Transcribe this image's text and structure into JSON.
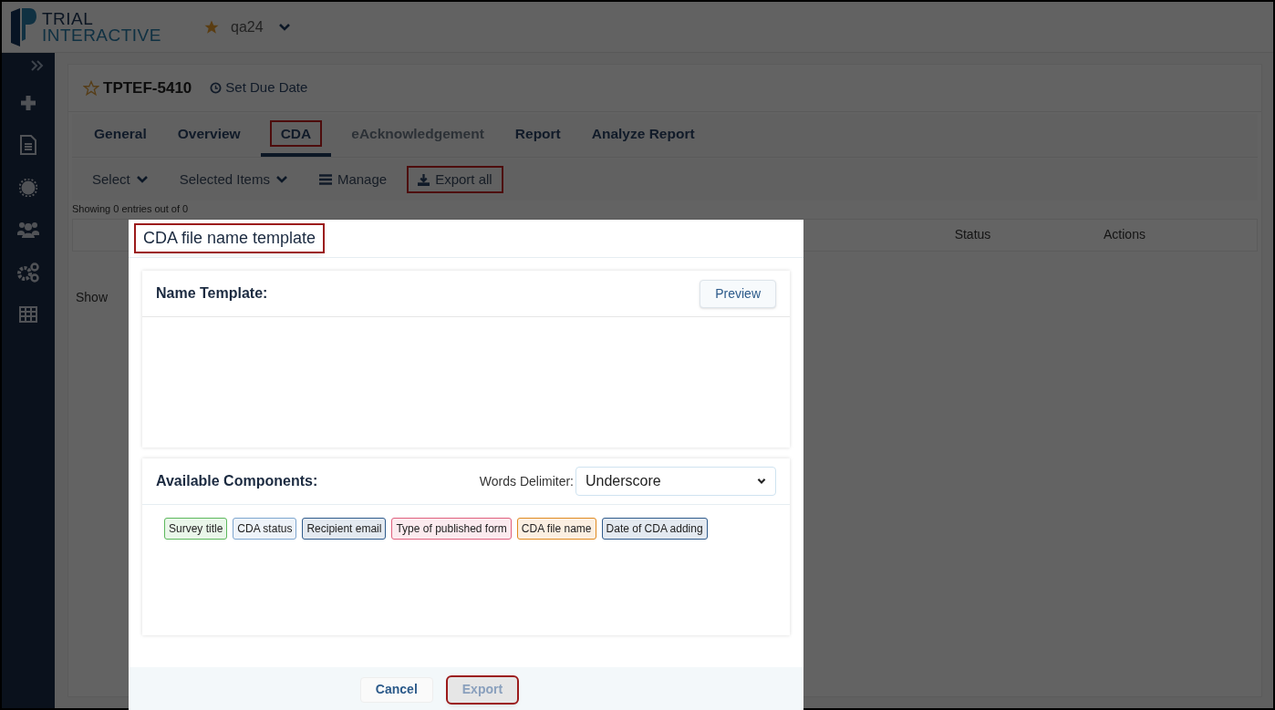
{
  "header": {
    "logo_line1": "TRIAL",
    "logo_line2": "INTERACTIVE",
    "workspace": "qa24"
  },
  "page": {
    "title": "TPTEF-5410",
    "due_date": "Set Due Date",
    "tabs": [
      {
        "label": "General",
        "selected": false,
        "disabled": false,
        "highlighted": false
      },
      {
        "label": "Overview",
        "selected": false,
        "disabled": false,
        "highlighted": false
      },
      {
        "label": "CDA",
        "selected": true,
        "disabled": false,
        "highlighted": true
      },
      {
        "label": "eAcknowledgement",
        "selected": false,
        "disabled": true,
        "highlighted": false
      },
      {
        "label": "Report",
        "selected": false,
        "disabled": false,
        "highlighted": false
      },
      {
        "label": "Analyze Report",
        "selected": false,
        "disabled": false,
        "highlighted": false
      }
    ],
    "toolbar": [
      {
        "kind": "dropdown",
        "label": "Select",
        "highlighted": false
      },
      {
        "kind": "dropdown",
        "label": "Selected Items",
        "highlighted": false
      },
      {
        "kind": "manage",
        "label": "Manage",
        "highlighted": false
      },
      {
        "kind": "export",
        "label": "Export all",
        "highlighted": true
      }
    ],
    "entries_info": "Showing 0 entries out of 0",
    "table": {
      "columns": [
        "Status",
        "Actions"
      ]
    },
    "footer_text": "Show"
  },
  "modal": {
    "title": "CDA file name template",
    "title_highlighted": true,
    "name_template": {
      "label": "Name Template:",
      "preview_button": "Preview"
    },
    "components": {
      "label": "Available Components:",
      "delimiter_label": "Words Delimiter:",
      "delimiter_value": "Underscore",
      "chips": [
        {
          "label": "Survey title",
          "color": "#5cb85c"
        },
        {
          "label": "CDA status",
          "color": "#7ea6cf"
        },
        {
          "label": "Recipient email",
          "color": "#2f5b8c"
        },
        {
          "label": "Type of published form",
          "color": "#e0607e"
        },
        {
          "label": "CDA file name",
          "color": "#e08a20"
        },
        {
          "label": "Date of CDA adding",
          "color": "#2f5b8c"
        }
      ]
    },
    "buttons": [
      {
        "label": "Cancel",
        "disabled": false,
        "highlighted": false
      },
      {
        "label": "Export",
        "disabled": true,
        "highlighted": true
      }
    ]
  }
}
